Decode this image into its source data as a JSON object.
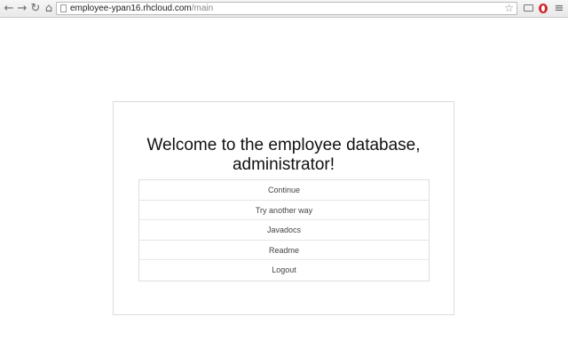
{
  "browser": {
    "url_host": "employee-ypan16.rhcloud.com",
    "url_path": "/main",
    "icons": [
      "back-icon",
      "forward-icon",
      "reload-icon",
      "home-icon",
      "page-icon",
      "bookmark-star-icon",
      "cast-icon",
      "opera-icon",
      "menu-icon"
    ]
  },
  "main": {
    "heading_line1": "Welcome to the employee database,",
    "heading_line2": "administrator!",
    "buttons": [
      {
        "label": "Continue"
      },
      {
        "label": "Try another way"
      },
      {
        "label": "Javadocs"
      },
      {
        "label": "Readme"
      },
      {
        "label": "Logout"
      }
    ]
  }
}
